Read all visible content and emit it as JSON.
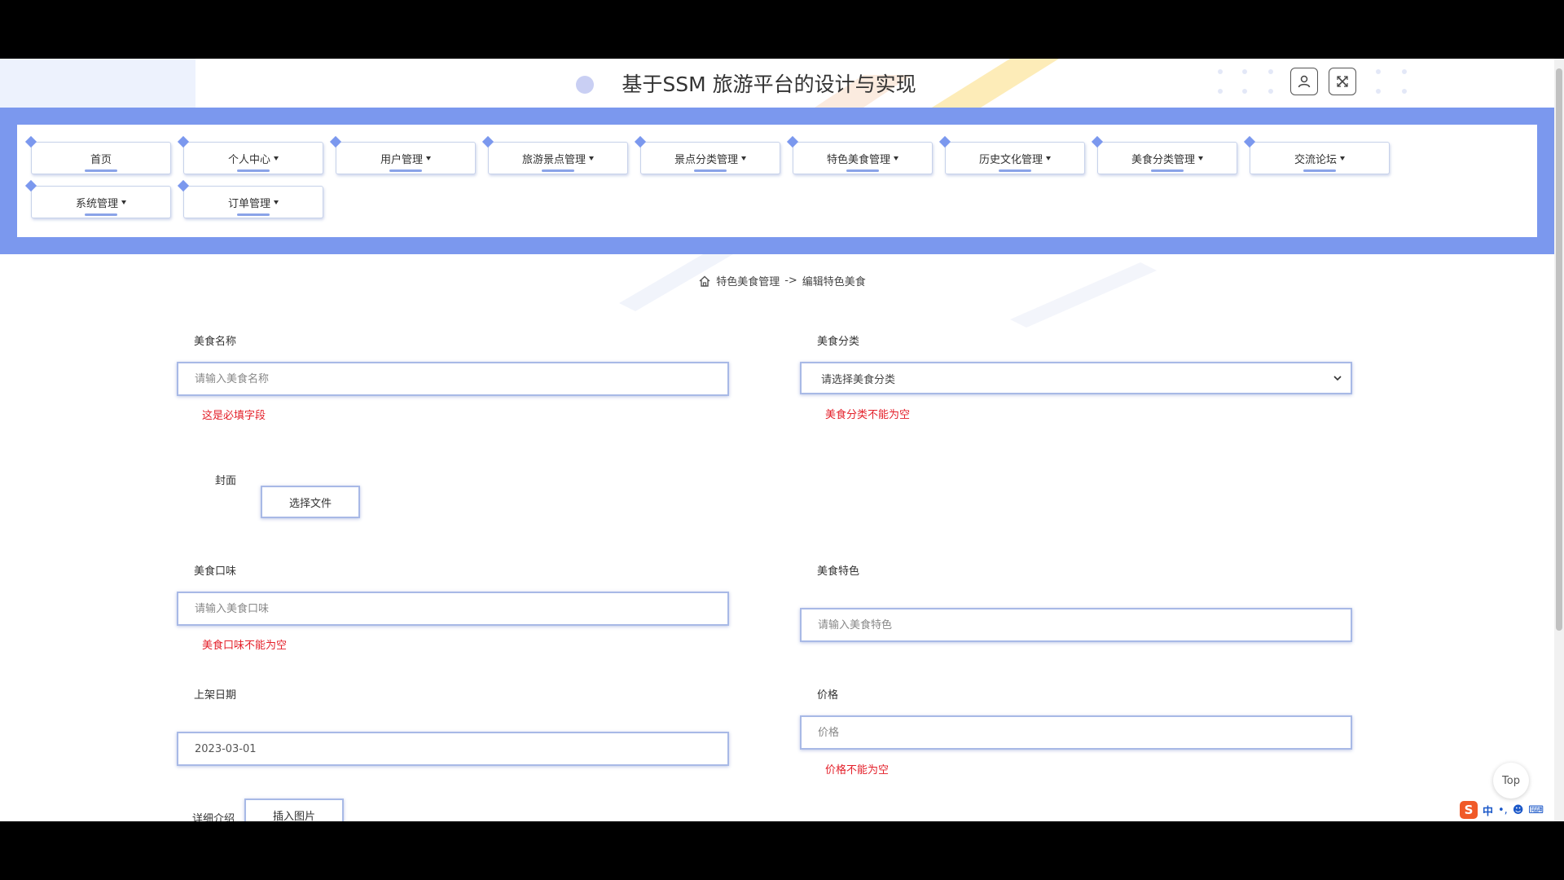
{
  "header": {
    "title": "基于SSM 旅游平台的设计与实现"
  },
  "nav": {
    "items": [
      {
        "label": "首页",
        "dropdown": false
      },
      {
        "label": "个人中心",
        "dropdown": true
      },
      {
        "label": "用户管理",
        "dropdown": true
      },
      {
        "label": "旅游景点管理",
        "dropdown": true
      },
      {
        "label": "景点分类管理",
        "dropdown": true
      },
      {
        "label": "特色美食管理",
        "dropdown": true
      },
      {
        "label": "历史文化管理",
        "dropdown": true
      },
      {
        "label": "美食分类管理",
        "dropdown": true
      },
      {
        "label": "交流论坛",
        "dropdown": true
      },
      {
        "label": "系统管理",
        "dropdown": true
      },
      {
        "label": "订单管理",
        "dropdown": true
      }
    ]
  },
  "breadcrumb": {
    "section": "特色美食管理",
    "separator": "->",
    "current": "编辑特色美食"
  },
  "form": {
    "food_name": {
      "label": "美食名称",
      "placeholder": "请输入美食名称",
      "value": "",
      "error": "这是必填字段"
    },
    "food_category": {
      "label": "美食分类",
      "selected": "请选择美食分类",
      "error": "美食分类不能为空"
    },
    "cover": {
      "label": "封面",
      "button": "选择文件"
    },
    "taste": {
      "label": "美食口味",
      "placeholder": "请输入美食口味",
      "value": "",
      "error": "美食口味不能为空"
    },
    "feature": {
      "label": "美食特色",
      "placeholder": "请输入美食特色",
      "value": ""
    },
    "listing_date": {
      "label": "上架日期",
      "value": "2023-03-01"
    },
    "price": {
      "label": "价格",
      "placeholder": "价格",
      "value": "",
      "error": "价格不能为空"
    },
    "detail": {
      "label": "详细介绍",
      "button": "插入图片"
    }
  },
  "floating": {
    "top_label": "Top",
    "ime_mode": "中"
  },
  "colors": {
    "nav_band": "#7b98ee",
    "error": "#e4202a",
    "input_border": "#a8b9e6"
  }
}
